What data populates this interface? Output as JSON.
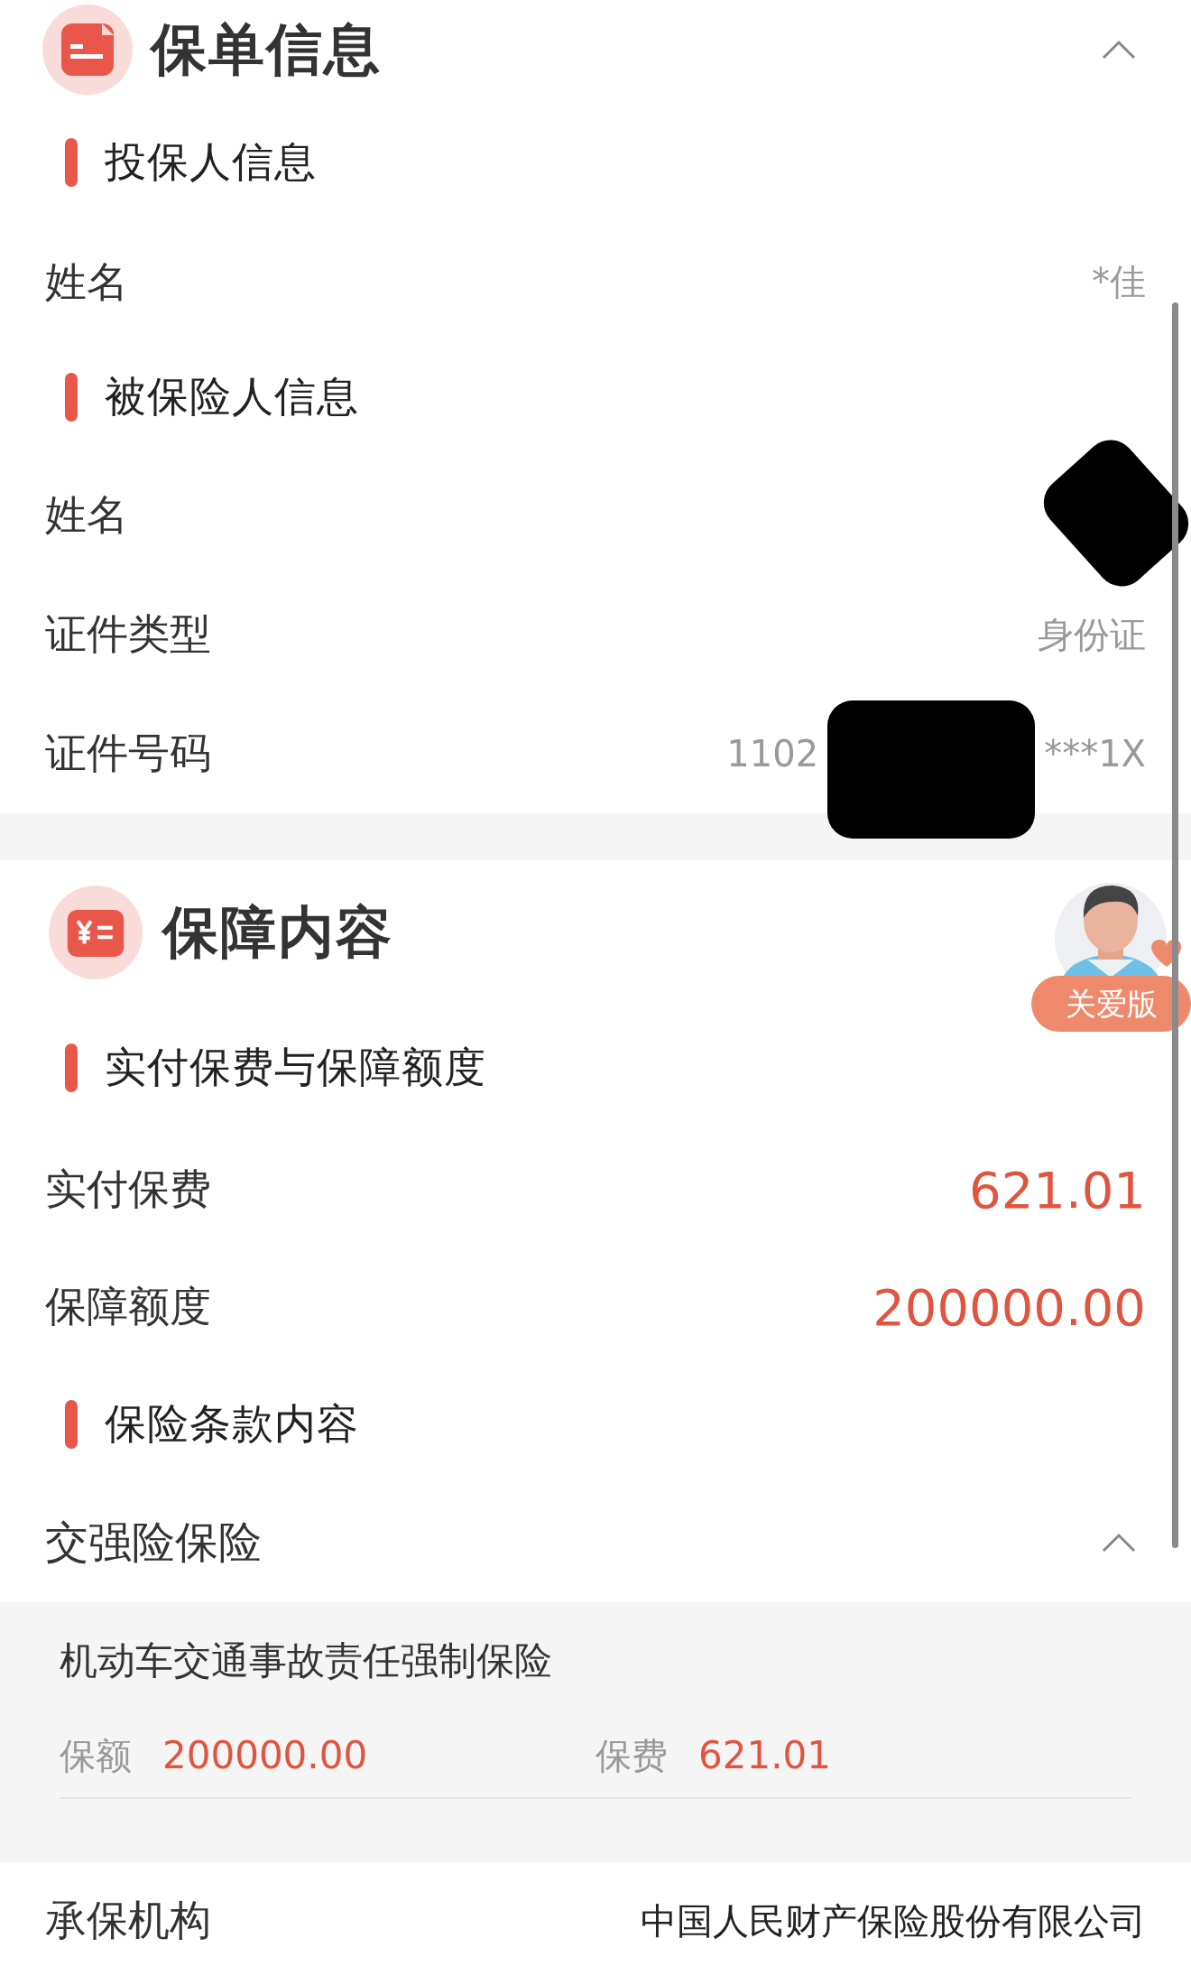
{
  "policy_info": {
    "title": "保单信息",
    "expanded": true,
    "groups": [
      {
        "heading": "投保人信息",
        "rows": [
          {
            "label": "姓名",
            "kind": "text",
            "value": "*佳"
          }
        ]
      },
      {
        "heading": "被保险人信息",
        "rows": [
          {
            "label": "姓名",
            "kind": "text",
            "redacted": true
          },
          {
            "label": "证件类型",
            "kind": "text",
            "value": "身份证"
          },
          {
            "label": "证件号码",
            "kind": "text",
            "value": "1102",
            "value_end": "***1X",
            "redacted": true
          }
        ]
      }
    ]
  },
  "coverage": {
    "title": "保障内容",
    "groups": [
      {
        "heading": "实付保费与保障额度",
        "rows": [
          {
            "label": "实付保费",
            "kind": "amount",
            "value": "621.01"
          },
          {
            "label": "保障额度",
            "kind": "amount",
            "value": "200000.00"
          }
        ]
      },
      {
        "heading": "保险条款内容"
      }
    ],
    "clause_group": {
      "title": "交强险保险",
      "expanded": true,
      "items": [
        {
          "name": "机动车交通事故责任强制保险",
          "sum_label": "保额",
          "sum": "200000.00",
          "premium_label": "保费",
          "premium": "621.01"
        }
      ]
    },
    "insurer": {
      "label": "承保机构",
      "value": "中国人民财产保险股份有限公司"
    }
  },
  "care_mode_badge": {
    "label": "关爱版"
  }
}
